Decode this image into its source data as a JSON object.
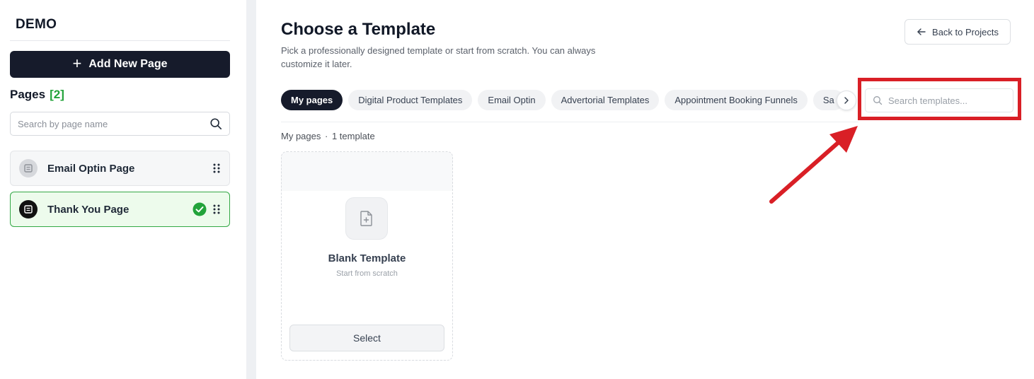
{
  "sidebar": {
    "project_title": "DEMO",
    "add_page_label": "Add New Page",
    "pages_heading": "Pages",
    "pages_count": "[2]",
    "search_placeholder": "Search by page name",
    "items": [
      {
        "label": "Email Optin Page",
        "active": false
      },
      {
        "label": "Thank You Page",
        "active": true
      }
    ]
  },
  "main": {
    "title": "Choose a Template",
    "subtitle": "Pick a professionally designed template or start from scratch. You can always customize it later.",
    "back_label": "Back to Projects",
    "tabs": [
      {
        "label": "My pages",
        "active": true
      },
      {
        "label": "Digital Product Templates",
        "active": false
      },
      {
        "label": "Email Optin",
        "active": false
      },
      {
        "label": "Advertorial Templates",
        "active": false
      },
      {
        "label": "Appointment Booking Funnels",
        "active": false
      },
      {
        "label": "Sa",
        "active": false
      }
    ],
    "search_placeholder": "Search templates...",
    "section_name": "My pages",
    "section_separator": "·",
    "section_count": "1 template",
    "card": {
      "title": "Blank Template",
      "subtitle": "Start from scratch",
      "select_label": "Select"
    }
  },
  "colors": {
    "primary_dark": "#161b2b",
    "success_green": "#22a33a",
    "annotation_red": "#d91f26"
  },
  "icons": {
    "add": "plus-icon",
    "search": "search-icon",
    "page": "page-icon",
    "check": "check-circle-icon",
    "drag": "drag-handle-icon",
    "back": "arrow-left-icon",
    "next": "chevron-right-icon",
    "file": "file-plus-icon"
  }
}
